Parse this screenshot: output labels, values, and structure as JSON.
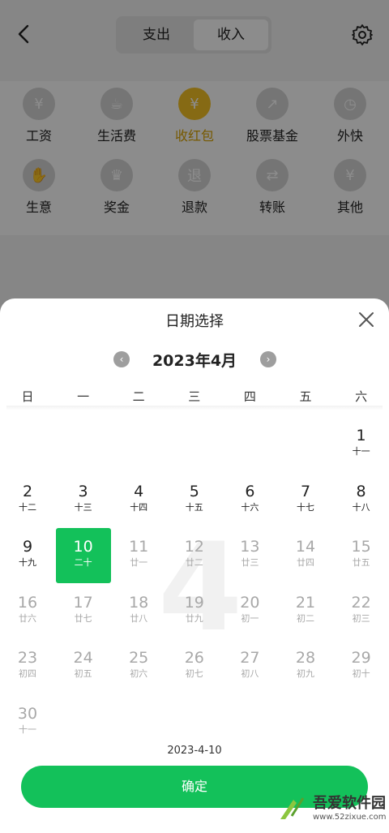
{
  "header": {
    "tabs": [
      "支出",
      "收入"
    ],
    "active_tab": "收入"
  },
  "categories": [
    {
      "label": "工资",
      "icon": "money-bag-icon",
      "glyph": "¥"
    },
    {
      "label": "生活费",
      "icon": "cup-icon",
      "glyph": "☕"
    },
    {
      "label": "收红包",
      "icon": "red-envelope-icon",
      "glyph": "¥",
      "active": true
    },
    {
      "label": "股票基金",
      "icon": "stock-chart-icon",
      "glyph": "↗"
    },
    {
      "label": "外快",
      "icon": "clock-icon",
      "glyph": "◷"
    },
    {
      "label": "生意",
      "icon": "handshake-icon",
      "glyph": "✋"
    },
    {
      "label": "奖金",
      "icon": "crown-icon",
      "glyph": "♛"
    },
    {
      "label": "退款",
      "icon": "refund-icon",
      "glyph": "退"
    },
    {
      "label": "转账",
      "icon": "transfer-icon",
      "glyph": "⇄"
    },
    {
      "label": "其他",
      "icon": "other-icon",
      "glyph": "¥"
    }
  ],
  "picker": {
    "title": "日期选择",
    "month_label": "2023年4月",
    "big_month": "4",
    "weekdays": [
      "日",
      "一",
      "二",
      "三",
      "四",
      "五",
      "六"
    ],
    "selected_date": "2023-4-10",
    "confirm_label": "确定",
    "days": [
      {
        "d": "1",
        "l": "十一",
        "col": 6,
        "row": 0
      },
      {
        "d": "2",
        "l": "十二",
        "col": 0,
        "row": 1
      },
      {
        "d": "3",
        "l": "十三",
        "col": 1,
        "row": 1
      },
      {
        "d": "4",
        "l": "十四",
        "col": 2,
        "row": 1
      },
      {
        "d": "5",
        "l": "十五",
        "col": 3,
        "row": 1
      },
      {
        "d": "6",
        "l": "十六",
        "col": 4,
        "row": 1
      },
      {
        "d": "7",
        "l": "十七",
        "col": 5,
        "row": 1
      },
      {
        "d": "8",
        "l": "十八",
        "col": 6,
        "row": 1
      },
      {
        "d": "9",
        "l": "十九",
        "col": 0,
        "row": 2
      },
      {
        "d": "10",
        "l": "二十",
        "col": 1,
        "row": 2,
        "selected": true
      },
      {
        "d": "11",
        "l": "廿一",
        "col": 2,
        "row": 2,
        "dim": true
      },
      {
        "d": "12",
        "l": "廿二",
        "col": 3,
        "row": 2,
        "dim": true
      },
      {
        "d": "13",
        "l": "廿三",
        "col": 4,
        "row": 2,
        "dim": true
      },
      {
        "d": "14",
        "l": "廿四",
        "col": 5,
        "row": 2,
        "dim": true
      },
      {
        "d": "15",
        "l": "廿五",
        "col": 6,
        "row": 2,
        "dim": true
      },
      {
        "d": "16",
        "l": "廿六",
        "col": 0,
        "row": 3,
        "dim": true
      },
      {
        "d": "17",
        "l": "廿七",
        "col": 1,
        "row": 3,
        "dim": true
      },
      {
        "d": "18",
        "l": "廿八",
        "col": 2,
        "row": 3,
        "dim": true
      },
      {
        "d": "19",
        "l": "廿九",
        "col": 3,
        "row": 3,
        "dim": true
      },
      {
        "d": "20",
        "l": "初一",
        "col": 4,
        "row": 3,
        "dim": true
      },
      {
        "d": "21",
        "l": "初二",
        "col": 5,
        "row": 3,
        "dim": true
      },
      {
        "d": "22",
        "l": "初三",
        "col": 6,
        "row": 3,
        "dim": true
      },
      {
        "d": "23",
        "l": "初四",
        "col": 0,
        "row": 4,
        "dim": true
      },
      {
        "d": "24",
        "l": "初五",
        "col": 1,
        "row": 4,
        "dim": true
      },
      {
        "d": "25",
        "l": "初六",
        "col": 2,
        "row": 4,
        "dim": true
      },
      {
        "d": "26",
        "l": "初七",
        "col": 3,
        "row": 4,
        "dim": true
      },
      {
        "d": "27",
        "l": "初八",
        "col": 4,
        "row": 4,
        "dim": true
      },
      {
        "d": "28",
        "l": "初九",
        "col": 5,
        "row": 4,
        "dim": true
      },
      {
        "d": "29",
        "l": "初十",
        "col": 6,
        "row": 4,
        "dim": true
      },
      {
        "d": "30",
        "l": "十一",
        "col": 0,
        "row": 5,
        "dim": true
      }
    ]
  },
  "watermark": {
    "name": "吾爱软件园",
    "url": "www.52zixue.com"
  },
  "colors": {
    "accent": "#13c15a",
    "active_category": "#f5c125"
  }
}
